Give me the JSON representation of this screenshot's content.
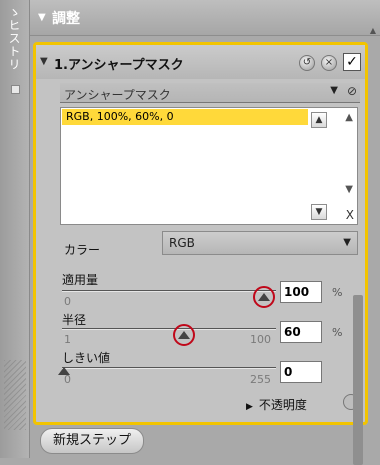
{
  "sidebar": {
    "vertical_label": "ヒストリ",
    "vertical_label_prefix": "ゝ"
  },
  "header": {
    "title": "調整"
  },
  "step": {
    "number": "1.",
    "title": "アンシャープマスク",
    "checked_mark": "✓"
  },
  "preset": {
    "label": "アンシャープマスク"
  },
  "list": {
    "items": [
      "RGB, 100%, 60%, 0"
    ],
    "delete_label": "X"
  },
  "color_option": {
    "label": "カラー",
    "value": "RGB"
  },
  "sliders": [
    {
      "label": "適用量",
      "value": "100",
      "min": "0",
      "max": "",
      "unit": "%",
      "position": 1.0
    },
    {
      "label": "半径",
      "value": "60",
      "min": "1",
      "max": "100",
      "unit": "%",
      "position": 0.6
    },
    {
      "label": "しきい値",
      "value": "0",
      "min": "0",
      "max": "255",
      "unit": "",
      "position": 0.0
    }
  ],
  "opacity": {
    "label": "不透明度"
  },
  "footer": {
    "new_step_label": "新規ステップ"
  },
  "colors": {
    "accent_border": "#f2c400",
    "selected_row": "#ffd93a",
    "highlight_ring": "#c0081a"
  }
}
